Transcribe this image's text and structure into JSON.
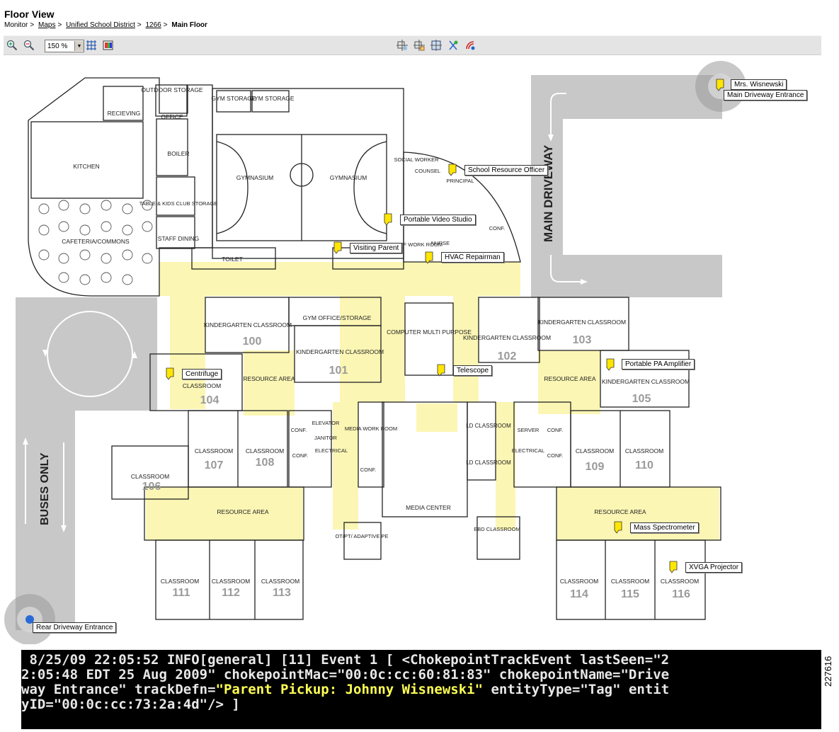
{
  "page": {
    "title": "Floor View"
  },
  "breadcrumb": {
    "items": [
      {
        "label": "Monitor",
        "link": false
      },
      {
        "label": "Maps",
        "link": true
      },
      {
        "label": "Unified School District",
        "link": true
      },
      {
        "label": "1266",
        "link": true
      },
      {
        "label": "Main Floor",
        "link": false,
        "current": true
      }
    ]
  },
  "toolbar": {
    "zoom_value": "150 %",
    "left_tools": [
      "zoom-in-icon",
      "zoom-out-icon",
      "grid-icon",
      "layers-icon"
    ],
    "right_tools": [
      "sync-icon",
      "edit-icon",
      "map-properties-icon",
      "tag-icon",
      "rf-icon"
    ]
  },
  "map": {
    "callouts": [
      {
        "id": "mrs-wisnewski",
        "label": "Mrs. Wisnewski"
      },
      {
        "id": "main-driveway-entrance",
        "label": "Main Driveway Entrance"
      },
      {
        "id": "school-resource-officer",
        "label": "School Resource Officer"
      },
      {
        "id": "portable-video-studio",
        "label": "Portable Video Studio"
      },
      {
        "id": "visiting-parent",
        "label": "Visiting Parent"
      },
      {
        "id": "hvac-repairman",
        "label": "HVAC Repairman"
      },
      {
        "id": "centrifuge",
        "label": "Centrifuge"
      },
      {
        "id": "telescope",
        "label": "Telescope"
      },
      {
        "id": "portable-pa-amplifier",
        "label": "Portable PA Amplifier"
      },
      {
        "id": "mass-spectrometer",
        "label": "Mass Spectrometer"
      },
      {
        "id": "xvga-projector",
        "label": "XVGA Projector"
      },
      {
        "id": "rear-driveway-entrance",
        "label": "Rear Driveway Entrance"
      }
    ],
    "rooms": {
      "outdoor_storage": "OUTDOOR STORAGE",
      "recieving": "RECIEVING",
      "office": "OFFICE",
      "kitchen": "KITCHEN",
      "boiler": "BOILER",
      "gym_storage": "GYM STORAGE",
      "gymnasium": "GYMNASIUM",
      "table_storage": "TABLE & KIDS CLUB STORAGE",
      "cafeteria": "CAFETERIA/COMMONS",
      "staff_dining": "STAFF DINING",
      "toilet": "TOILET",
      "social_worker": "SOCIAL WORKER",
      "counsel": "COUNSEL",
      "principal": "PRINCIPAL",
      "conf": "CONF.",
      "nurse": "NURSE",
      "staff_work_room": "STAFF WORK ROOM",
      "kindergarten_classroom": "KINDERGARTEN CLASSROOM",
      "gym_office": "GYM OFFICE/STORAGE",
      "computer_multi": "COMPUTER MULTI PURPOSE",
      "classroom": "CLASSROOM",
      "resource_area": "RESOURCE AREA",
      "elevator": "ELEVATOR",
      "janitor": "JANITOR",
      "electrical": "ELECTRICAL",
      "media_work_room": "MEDIA WORK ROOM",
      "media_center": "MEDIA CENTER",
      "ld_classroom": "LD CLASSROOM",
      "server": "SERVER",
      "ot_pt": "OT/PT/ ADAPTIVE PE",
      "ebd_classroom": "EBD CLASSROOM",
      "main_driveway": "MAIN DRIVEWAY",
      "buses_only": "BUSES ONLY"
    },
    "room_numbers": [
      "100",
      "101",
      "102",
      "103",
      "104",
      "105",
      "106",
      "107",
      "108",
      "109",
      "110",
      "111",
      "112",
      "113",
      "114",
      "115",
      "116"
    ]
  },
  "console": {
    "line1": " 8/25/09 22:05:52 INFO[general] [11] Event 1 [ <ChokepointTrackEvent lastSeen=\"2",
    "line2": "2:05:48 EDT 25 Aug 2009\" chokepointMac=\"00:0c:cc:60:81:83\" chokepointName=\"Drive",
    "line3_pre": "way Entrance\" trackDefn=",
    "line3_hl": "\"Parent Pickup: Johnny Wisnewski\"",
    "line3_post": " entityType=\"Tag\" entit",
    "line4": "yID=\"00:0c:cc:73:2a:4d\"/> ]"
  },
  "figure_number": "227616",
  "colors": {
    "corridor": "#fbf6b4",
    "road": "#c8c8c8",
    "toolbar": "#e4e4e4",
    "console_bg": "#000000",
    "console_highlight": "#ffff55"
  }
}
